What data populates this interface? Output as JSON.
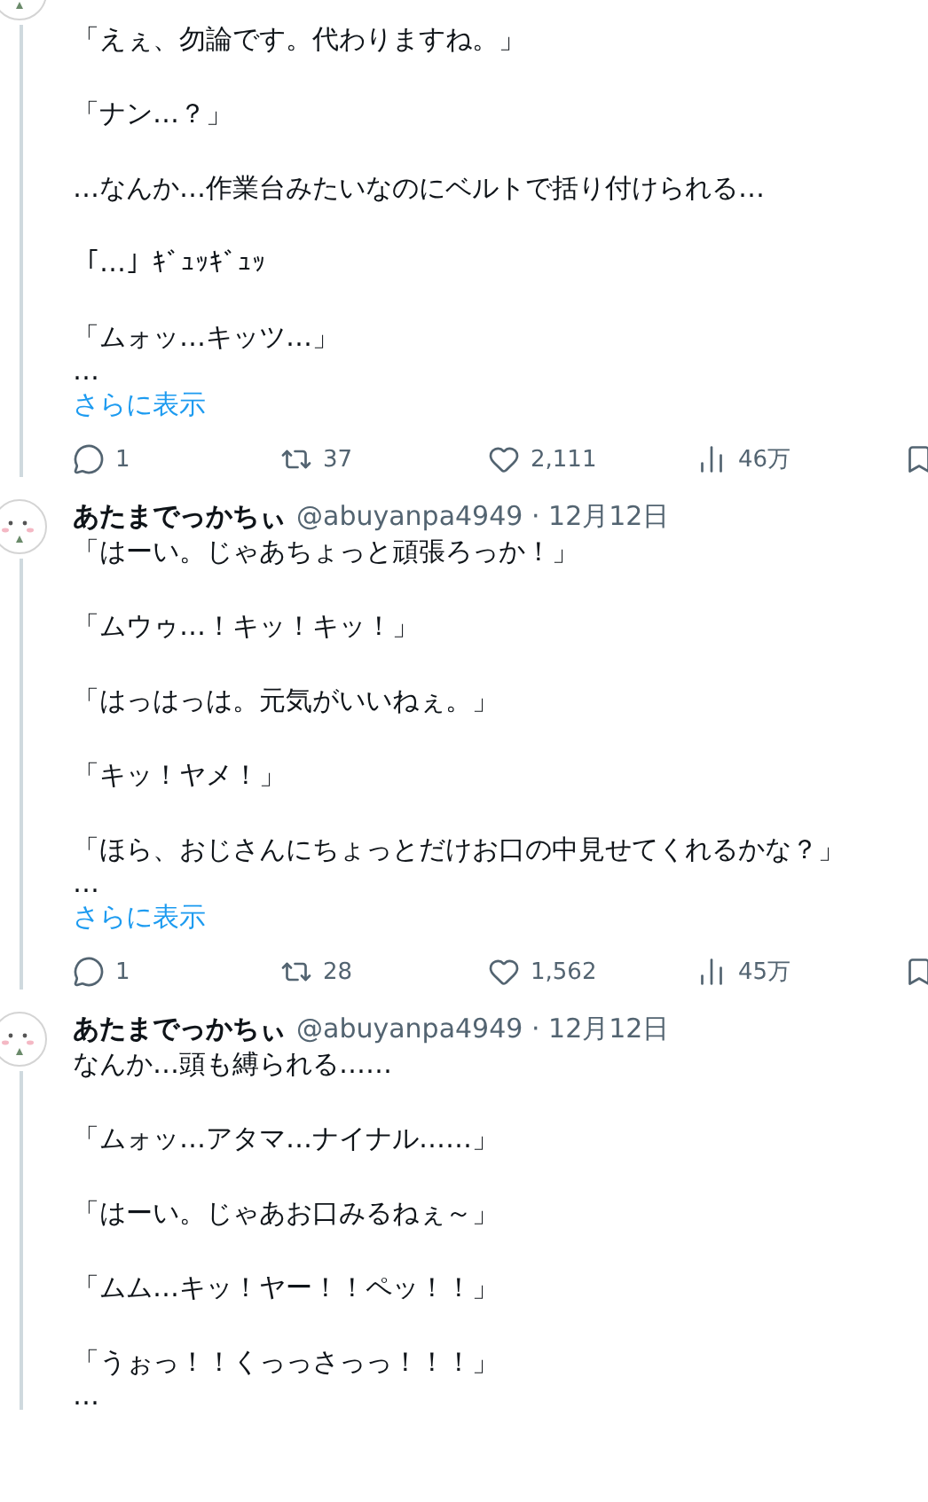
{
  "tweets": [
    {
      "paragraphs": [
        "「えぇ、勿論です。代わりますね。」",
        "「ナン…？」",
        "…なんか…作業台みたいなのにベルトで括り付けられる…",
        "「…」ｷﾞｭｯｷﾞｭｯ",
        "「ムォッ…キッツ…」"
      ],
      "ellipsis": "…",
      "show_more": "さらに表示",
      "actions": {
        "replies": "1",
        "reposts": "37",
        "likes": "2,111",
        "views": "46万"
      }
    },
    {
      "author": "あたまでっかちぃ",
      "handle": "@abuyanpa4949",
      "separator": "·",
      "date": "12月12日",
      "paragraphs": [
        "「はーい。じゃあちょっと頑張ろっか！」",
        "「ムウゥ…！キッ！キッ！」",
        "「はっはっは。元気がいいねぇ。」",
        "「キッ！ヤメ！」",
        "「ほら、おじさんにちょっとだけお口の中見せてくれるかな？」"
      ],
      "ellipsis": "…",
      "show_more": "さらに表示",
      "actions": {
        "replies": "1",
        "reposts": "28",
        "likes": "1,562",
        "views": "45万"
      }
    },
    {
      "author": "あたまでっかちぃ",
      "handle": "@abuyanpa4949",
      "separator": "·",
      "date": "12月12日",
      "paragraphs": [
        "なんか…頭も縛られる……",
        "「ムォッ…アタマ…ナイナル……」",
        "「はーい。じゃあお口みるねぇ～」",
        "「ムム…キッ！ヤー！！ペッ！！」",
        "「うぉっ！！くっっさっっ！！！」"
      ],
      "ellipsis": "…"
    }
  ]
}
